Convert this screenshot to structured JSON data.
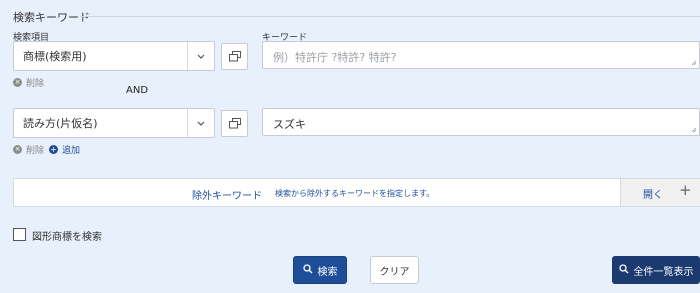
{
  "section": {
    "title": "検索キーワード"
  },
  "labels": {
    "search_item": "検索項目",
    "keyword": "キーワード"
  },
  "rows": [
    {
      "field_value": "商標(検索用)",
      "keyword_value": "",
      "keyword_placeholder": "例）特許庁 ?特許? 特許?",
      "delete_label": "削除"
    },
    {
      "field_value": "読み方(片仮名)",
      "keyword_value": "スズキ",
      "keyword_placeholder": "",
      "delete_label": "削除",
      "add_label": "追加"
    }
  ],
  "operator": "AND",
  "exclude": {
    "title": "除外キーワード",
    "description": "検索から除外するキーワードを指定します。",
    "open_label": "開く",
    "open_icon": "+"
  },
  "figure_search": {
    "label": "図形商標を検索"
  },
  "buttons": {
    "search": "検索",
    "clear": "クリア",
    "list_all": "全件一覧表示"
  },
  "icons": {
    "chevron": "chevron-down-icon",
    "popup": "window-popup-icon",
    "search": "search-icon"
  },
  "colors": {
    "background": "#e8f1fb",
    "primary": "#1f4e99",
    "dark_button": "#1a3a70"
  }
}
